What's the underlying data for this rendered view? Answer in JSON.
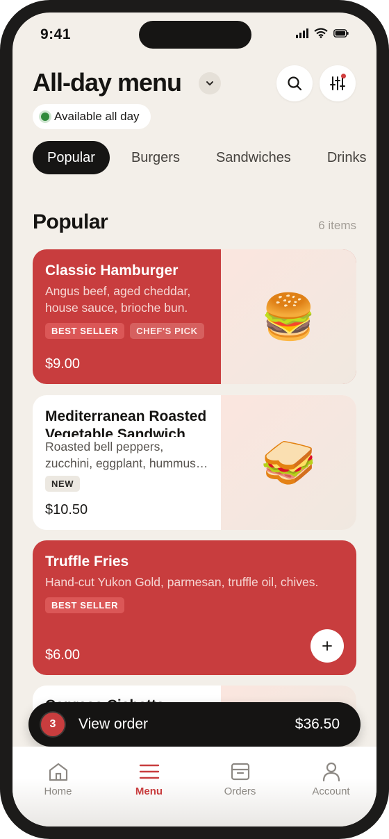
{
  "status_bar": {
    "time": "9:41"
  },
  "header": {
    "title": "All-day menu",
    "availability": "Available all day"
  },
  "tabs": [
    {
      "label": "Popular",
      "active": true
    },
    {
      "label": "Burgers",
      "active": false
    },
    {
      "label": "Sandwiches",
      "active": false
    },
    {
      "label": "Drinks",
      "active": false
    }
  ],
  "section": {
    "title": "Popular",
    "count": "6 items"
  },
  "items": [
    {
      "name": "Classic Hamburger",
      "description": "Angus beef, aged cheddar, house sauce, brioche bun.",
      "badges": [
        "BEST SELLER",
        "CHEF'S PICK"
      ],
      "price": "$9.00",
      "emoji": "🍔"
    },
    {
      "name": "Mediterranean Roasted Vegetable Sandwich",
      "description_line1": "Roasted bell peppers,",
      "description_line2": "zucchini, eggplant, hummus, feta.",
      "badges": [
        "NEW"
      ],
      "price": "$10.50",
      "emoji": "🥪"
    },
    {
      "name": "Truffle Fries",
      "description": "Hand-cut Yukon Gold, parmesan, truffle oil, chives.",
      "badges": [
        "BEST SELLER"
      ],
      "price": "$6.00"
    },
    {
      "name": "Caprese Ciabatta"
    }
  ],
  "order_bar": {
    "count": "3",
    "label": "View order",
    "total": "$36.50"
  },
  "tabbar": [
    {
      "label": "Home",
      "icon": "home-icon"
    },
    {
      "label": "Menu",
      "icon": "menu-icon",
      "active": true
    },
    {
      "label": "Orders",
      "icon": "orders-icon"
    },
    {
      "label": "Account",
      "icon": "account-icon"
    }
  ],
  "colors": {
    "accent": "#c83d3e",
    "dark": "#151413",
    "background": "#f3efe9",
    "available": "#2f8a3b"
  }
}
